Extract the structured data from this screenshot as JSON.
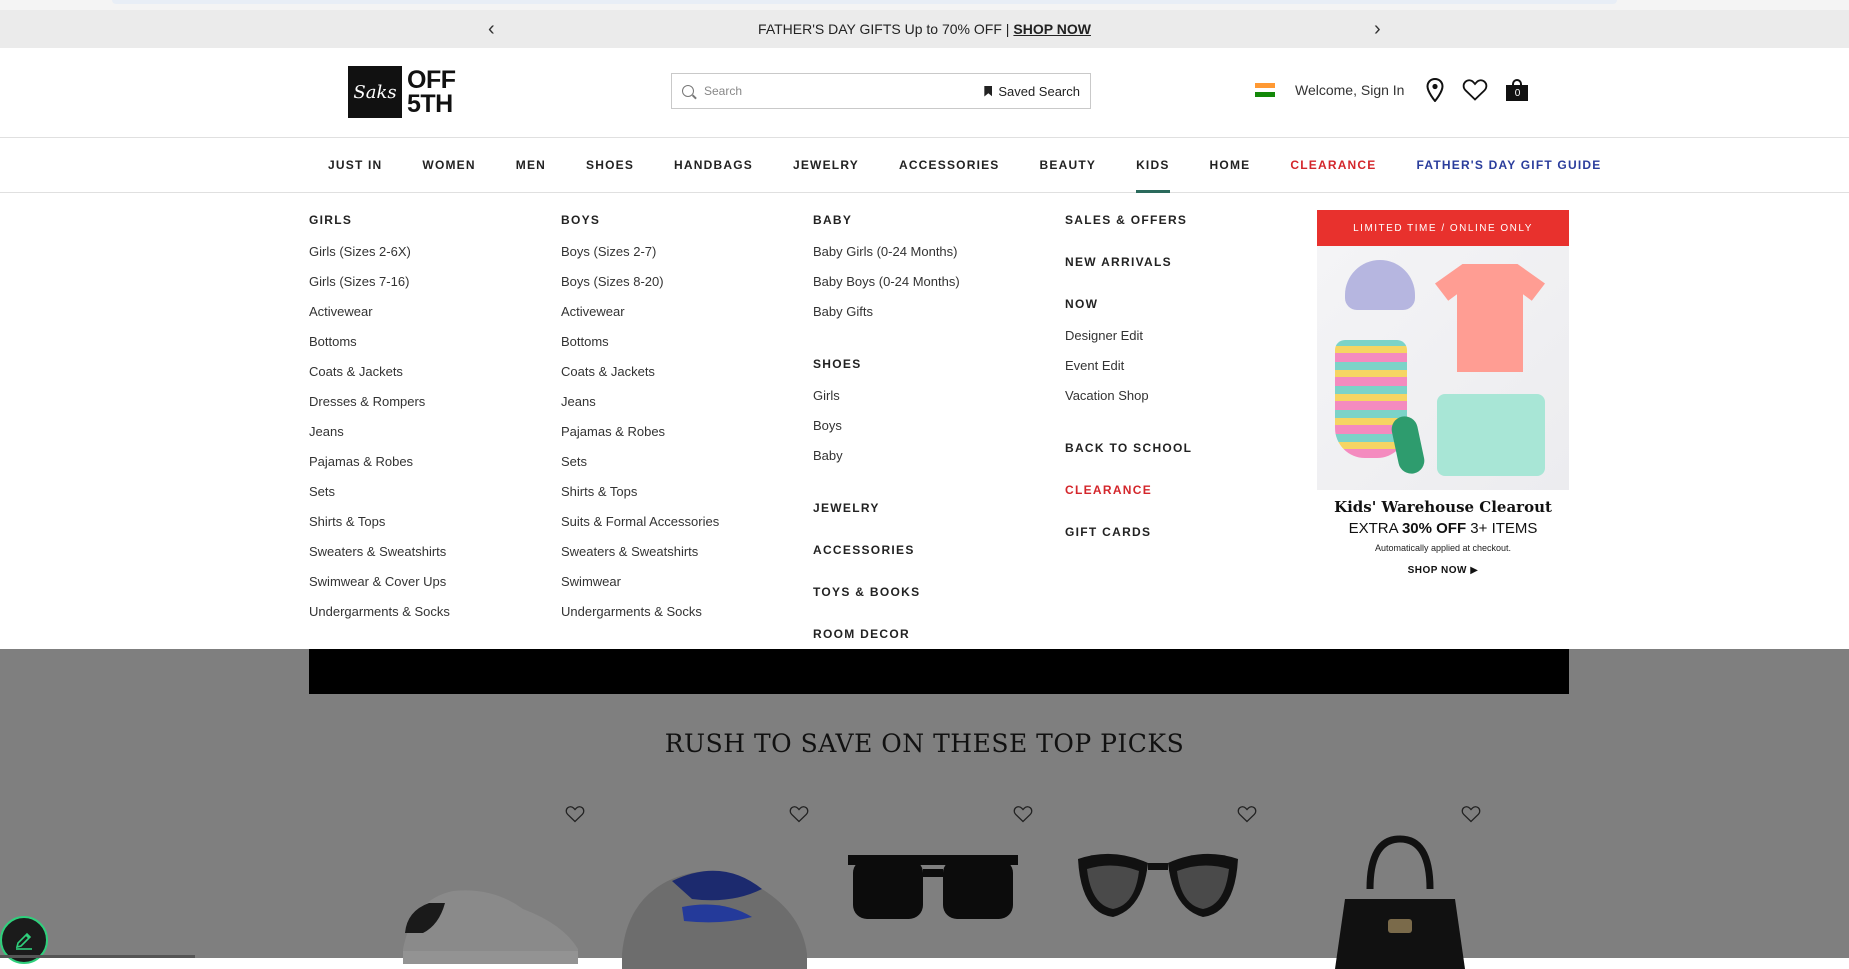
{
  "promo": {
    "text": "FATHER'S DAY GIFTS Up to 70% OFF |",
    "cta": "SHOP NOW"
  },
  "header": {
    "logo_script": "Saks",
    "logo_line1": "OFF",
    "logo_line2": "5TH",
    "search_placeholder": "Search",
    "saved_search": "Saved Search",
    "welcome": "Welcome, Sign In",
    "cart_count": "0"
  },
  "nav": {
    "items": [
      "JUST IN",
      "WOMEN",
      "MEN",
      "SHOES",
      "HANDBAGS",
      "JEWELRY",
      "ACCESSORIES",
      "BEAUTY",
      "KIDS",
      "HOME",
      "CLEARANCE",
      "FATHER'S DAY GIFT GUIDE"
    ],
    "active": "KIDS"
  },
  "mega": {
    "girls": {
      "title": "GIRLS",
      "items": [
        "Girls (Sizes 2-6X)",
        "Girls (Sizes 7-16)",
        "Activewear",
        "Bottoms",
        "Coats & Jackets",
        "Dresses & Rompers",
        "Jeans",
        "Pajamas & Robes",
        "Sets",
        "Shirts & Tops",
        "Sweaters & Sweatshirts",
        "Swimwear & Cover Ups",
        "Undergarments & Socks"
      ]
    },
    "boys": {
      "title": "BOYS",
      "items": [
        "Boys (Sizes 2-7)",
        "Boys (Sizes 8-20)",
        "Activewear",
        "Bottoms",
        "Coats & Jackets",
        "Jeans",
        "Pajamas & Robes",
        "Sets",
        "Shirts & Tops",
        "Suits & Formal Accessories",
        "Sweaters & Sweatshirts",
        "Swimwear",
        "Undergarments & Socks"
      ]
    },
    "baby": {
      "title": "BABY",
      "items": [
        "Baby Girls (0-24 Months)",
        "Baby Boys (0-24 Months)",
        "Baby Gifts"
      ]
    },
    "shoes": {
      "title": "SHOES",
      "items": [
        "Girls",
        "Boys",
        "Baby"
      ]
    },
    "jewelry": "JEWELRY",
    "accessories": "ACCESSORIES",
    "toys": "TOYS & BOOKS",
    "room": "ROOM DECOR",
    "sales": "SALES & OFFERS",
    "new_arrivals": "NEW ARRIVALS",
    "now": {
      "title": "NOW",
      "items": [
        "Designer Edit",
        "Event Edit",
        "Vacation Shop"
      ]
    },
    "back_to_school": "BACK TO SCHOOL",
    "clearance": "CLEARANCE",
    "gift_cards": "GIFT CARDS"
  },
  "ad": {
    "ribbon": "LIMITED TIME / ONLINE ONLY",
    "headline": "Kids' Warehouse Clearout",
    "offer_prefix": "EXTRA",
    "offer_bold": "30% OFF",
    "offer_suffix": "3+ ITEMS",
    "note": "Automatically applied at checkout.",
    "cta": "SHOP NOW ▶"
  },
  "section": {
    "title": "RUSH TO SAVE ON THESE TOP PICKS"
  },
  "colors": {
    "clearance": "#d4262b",
    "gift_guide": "#2a3d9c",
    "active_underline": "#2a6a5c",
    "ribbon": "#e8312d"
  }
}
